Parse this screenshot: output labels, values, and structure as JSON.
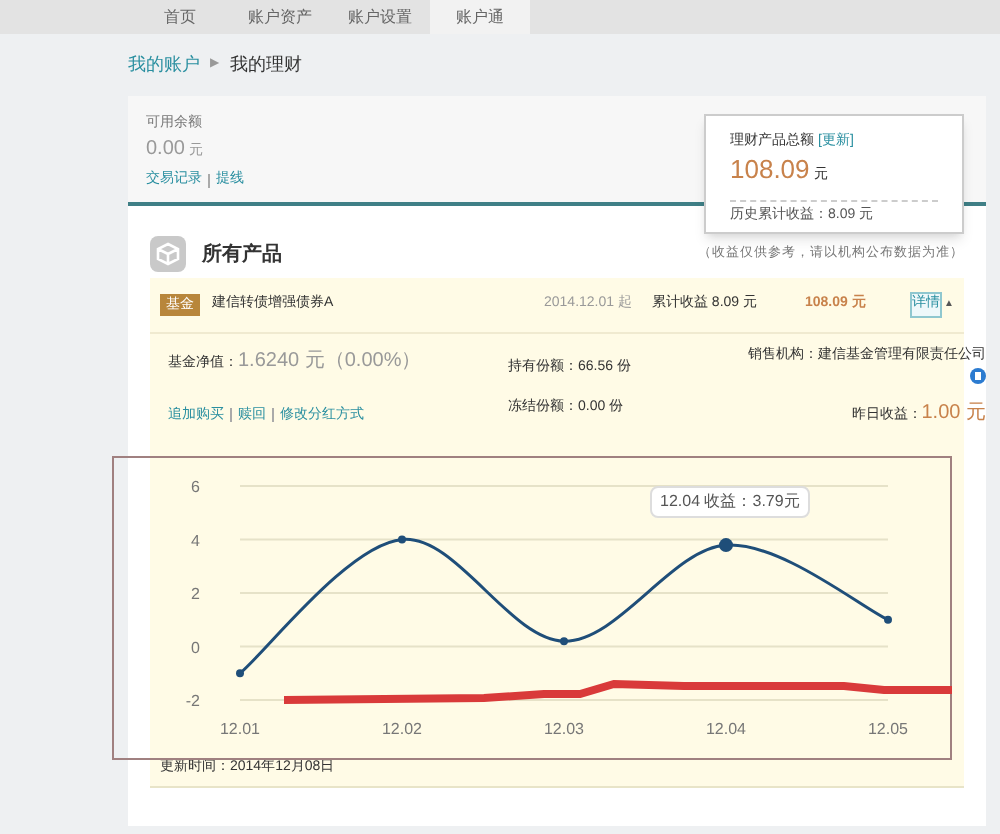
{
  "nav": {
    "tabs": [
      {
        "label": "首页",
        "selected": false
      },
      {
        "label": "账户资产",
        "selected": false
      },
      {
        "label": "账户设置",
        "selected": false
      },
      {
        "label": "账户通",
        "selected": true
      }
    ]
  },
  "breadcrumb": {
    "parent": "我的账户",
    "separator": "▶",
    "current": "我的理财"
  },
  "balance": {
    "label": "可用余额",
    "amount": "0.00",
    "unit": "元",
    "links": [
      "交易记录",
      "提线"
    ]
  },
  "summary": {
    "label": "理财产品总额",
    "refresh": "[更新]",
    "amount": "108.09",
    "unit": "元",
    "history": "历史累计收益：8.09 元"
  },
  "section": {
    "title": "所有产品",
    "note": "（收益仅供参考，请以机构公布数据为准）"
  },
  "product": {
    "tag": "基金",
    "name": "建信转债增强债券A",
    "date": "2014.12.01 起",
    "earnings": "累计收益 8.09 元",
    "amount": "108.09 元",
    "detail": "详情",
    "caret": "▲",
    "expanded": true,
    "nav_label": "基金净值：",
    "nav_value": "1.6240 元（0.00%）",
    "held": "持有份额：66.56 份",
    "frozen": "冻结份额：0.00 份",
    "seller": "销售机构：建信基金管理有限责任公司",
    "yesterday_label": "昨日收益：",
    "yesterday_value": "1.00 元",
    "actions": [
      "追加购买",
      "赎回",
      "修改分红方式"
    ]
  },
  "chart": {
    "tooltip": "12.04 收益：3.79元",
    "chart_data": {
      "type": "line",
      "categories": [
        "12.01",
        "12.02",
        "12.03",
        "12.04",
        "12.05"
      ],
      "series": [
        {
          "color": "#1f4e79",
          "marker": "circle",
          "values": [
            -1,
            4,
            0.2,
            3.79,
            1
          ]
        }
      ],
      "grid": true,
      "ylim": [
        -2,
        6
      ],
      "yticks": [
        -2,
        0,
        2,
        4,
        6
      ]
    }
  },
  "updated": "更新时间：2014年12月08日"
}
